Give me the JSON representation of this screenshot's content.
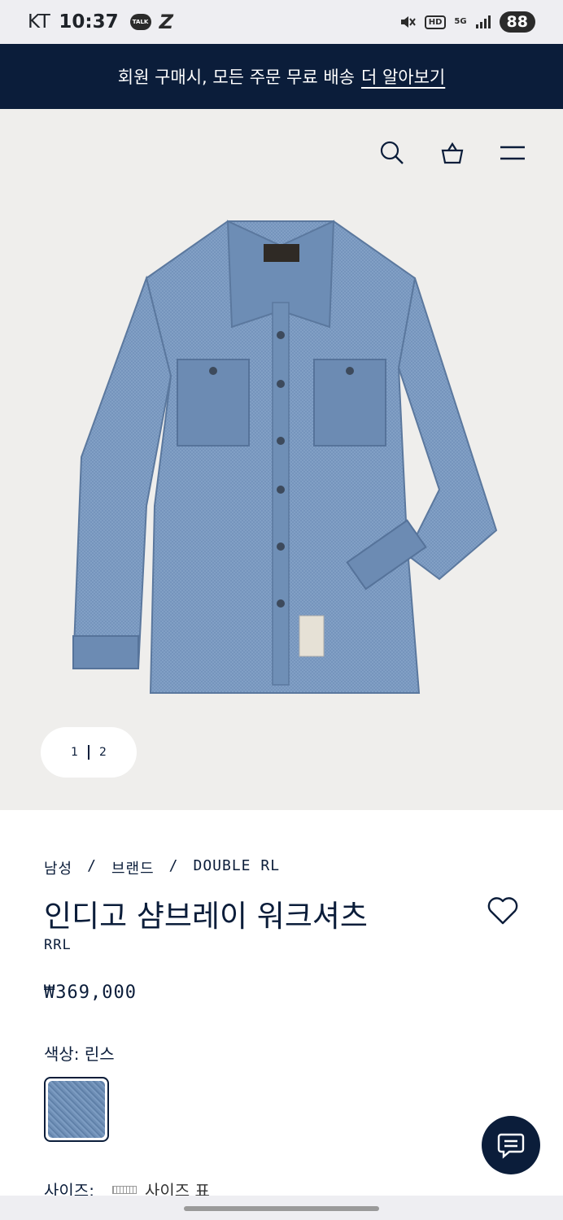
{
  "status_bar": {
    "carrier": "KT",
    "time": "10:37",
    "talk": "TALK",
    "hd": "HD",
    "network": "5G",
    "battery": "88"
  },
  "promo": {
    "text": "회원 구매시, 모든 주문 무료 배송",
    "link": "더 알아보기"
  },
  "gallery": {
    "current": "1",
    "total": "2"
  },
  "product": {
    "breadcrumb": [
      "남성",
      "/",
      "브랜드",
      "/",
      "DOUBLE RL"
    ],
    "title": "인디고 샴브레이 워크셔츠",
    "brand": "RRL",
    "price": "₩369,000",
    "color_label": "색상: 린스",
    "size_label": "사이즈:",
    "size_chart": "사이즈 표"
  },
  "colors": {
    "navy": "#0b1d3a",
    "hero_bg": "#efeeec",
    "denim": "#6f8fb6"
  }
}
